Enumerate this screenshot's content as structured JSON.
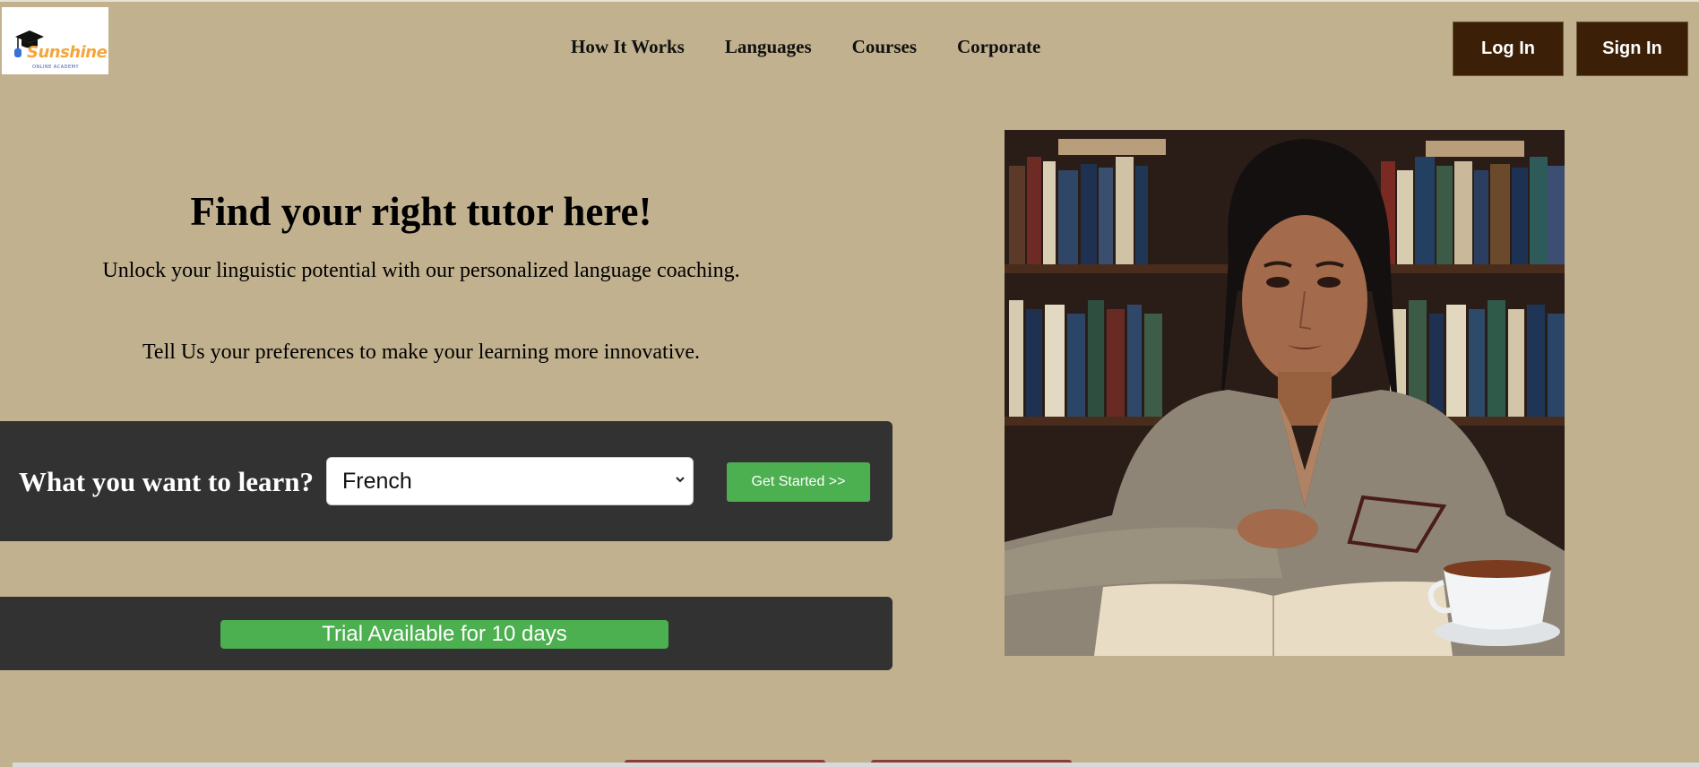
{
  "brand": {
    "name": "Sunshine",
    "tagline": "ONLINE ACADEMY"
  },
  "nav": {
    "items": [
      {
        "label": "How It Works"
      },
      {
        "label": "Languages"
      },
      {
        "label": "Courses"
      },
      {
        "label": "Corporate"
      }
    ]
  },
  "auth": {
    "login_label": "Log In",
    "signin_label": "Sign In"
  },
  "hero": {
    "title": "Find your right tutor here!",
    "subtitle": "Unlock your linguistic potential with our personalized language coaching.",
    "preferences": "Tell Us your preferences to make your learning more innovative."
  },
  "learn": {
    "label": "What you want to learn?",
    "selected_language": "French",
    "cta_label": "Get Started >>"
  },
  "trial": {
    "label": "Trial Available for 10 days"
  },
  "colors": {
    "page_bg": "#c1b18e",
    "panel_bg": "#323232",
    "auth_button": "#3b1f06",
    "accent_green": "#4caf50",
    "brand_orange": "#f4a53c"
  },
  "icons": {
    "logo": "graduation-cap-icon",
    "select_arrow": "chevron-down-icon"
  }
}
